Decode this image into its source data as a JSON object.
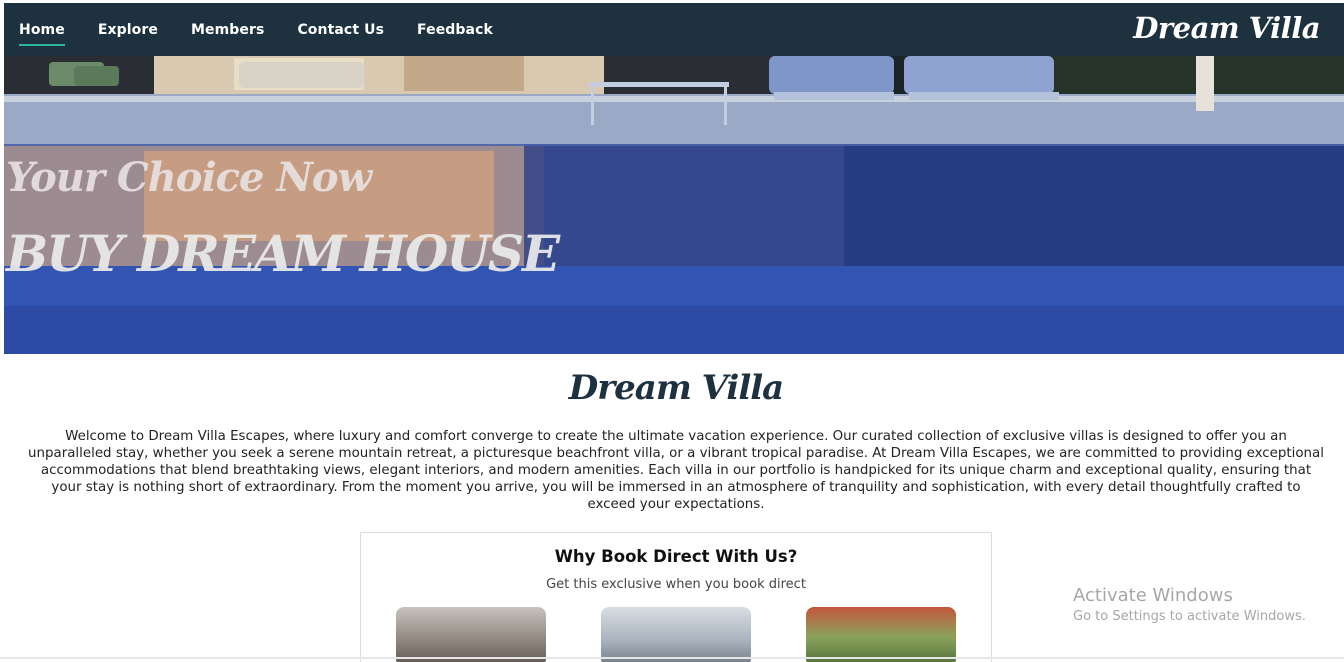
{
  "navbar": {
    "items": [
      {
        "label": "Home",
        "active": true
      },
      {
        "label": "Explore",
        "active": false
      },
      {
        "label": "Members",
        "active": false
      },
      {
        "label": "Contact Us",
        "active": false
      },
      {
        "label": "Feedback",
        "active": false
      }
    ],
    "brand": "Dream Villa",
    "background": "#1e313e",
    "active_indicator_color": "#2bb3a3"
  },
  "hero": {
    "subtitle": "Your Choice Now",
    "title": "BUY DREAM HOUSE",
    "image": "villa-pool-night"
  },
  "main": {
    "title": "Dream Villa",
    "intro": "Welcome to Dream Villa Escapes, where luxury and comfort converge to create the ultimate vacation experience. Our curated collection of exclusive villas is designed to offer you an unparalleled stay, whether you seek a serene mountain retreat, a picturesque beachfront villa, or a vibrant tropical paradise. At Dream Villa Escapes, we are committed to providing exceptional accommodations that blend breathtaking views, elegant interiors, and modern amenities. Each villa in our portfolio is handpicked for its unique charm and exceptional quality, ensuring that your stay is nothing short of extraordinary. From the moment you arrive, you will be immersed in an atmosphere of tranquility and sophistication, with every detail thoughtfully crafted to exceed your expectations."
  },
  "why_book": {
    "title": "Why Book Direct With Us?",
    "subtitle": "Get this exclusive when you book direct",
    "cards": [
      {
        "image": "villa-interior"
      },
      {
        "image": "laptop-booking"
      },
      {
        "image": "friends-outdoors"
      }
    ]
  },
  "watermark": {
    "title": "Activate Windows",
    "subtitle": "Go to Settings to activate Windows."
  }
}
